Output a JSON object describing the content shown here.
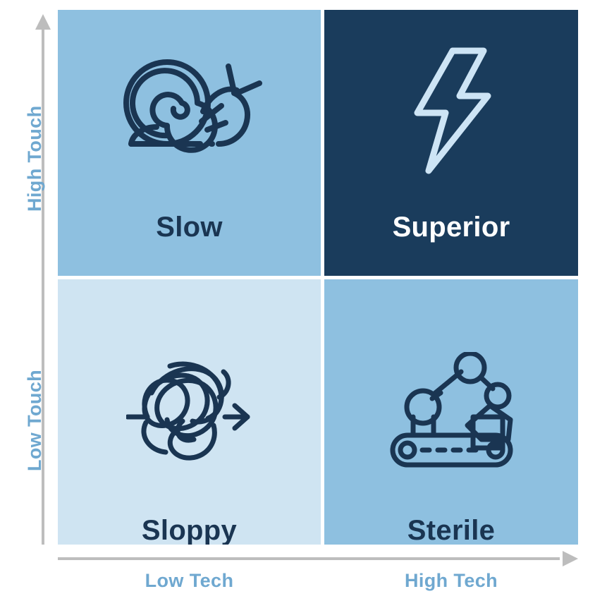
{
  "diagram": {
    "type": "2x2-matrix",
    "colors": {
      "quadrant_slow_bg": "#8ec0e0",
      "quadrant_superior_bg": "#1a3c5c",
      "quadrant_sloppy_bg": "#cfe4f2",
      "quadrant_sterile_bg": "#8ec0e0",
      "icon_dark": "#1a3552",
      "icon_light": "#cde4f5",
      "axis_line": "#bdbdbd",
      "axis_label": "#6fa8d0",
      "title_dark": "#1a3552",
      "title_light": "#ffffff"
    },
    "y_axis": {
      "high_label": "High Touch",
      "low_label": "Low Touch",
      "arrow": "arrow-up-icon"
    },
    "x_axis": {
      "low_label": "Low Tech",
      "high_label": "High Tech",
      "arrow": "arrow-right-icon"
    },
    "quadrants": [
      {
        "id": "slow",
        "title": "Slow",
        "icon": "snail-icon",
        "position": "top-left",
        "x_value": "Low Tech",
        "y_value": "High Touch"
      },
      {
        "id": "superior",
        "title": "Superior",
        "icon": "lightning-bolt-icon",
        "position": "top-right",
        "x_value": "High Tech",
        "y_value": "High Touch"
      },
      {
        "id": "sloppy",
        "title": "Sloppy",
        "icon": "tangled-scribble-arrow-icon",
        "position": "bottom-left",
        "x_value": "Low Tech",
        "y_value": "Low Touch"
      },
      {
        "id": "sterile",
        "title": "Sterile",
        "icon": "robot-arm-conveyor-icon",
        "position": "bottom-right",
        "x_value": "High Tech",
        "y_value": "Low Touch"
      }
    ]
  }
}
